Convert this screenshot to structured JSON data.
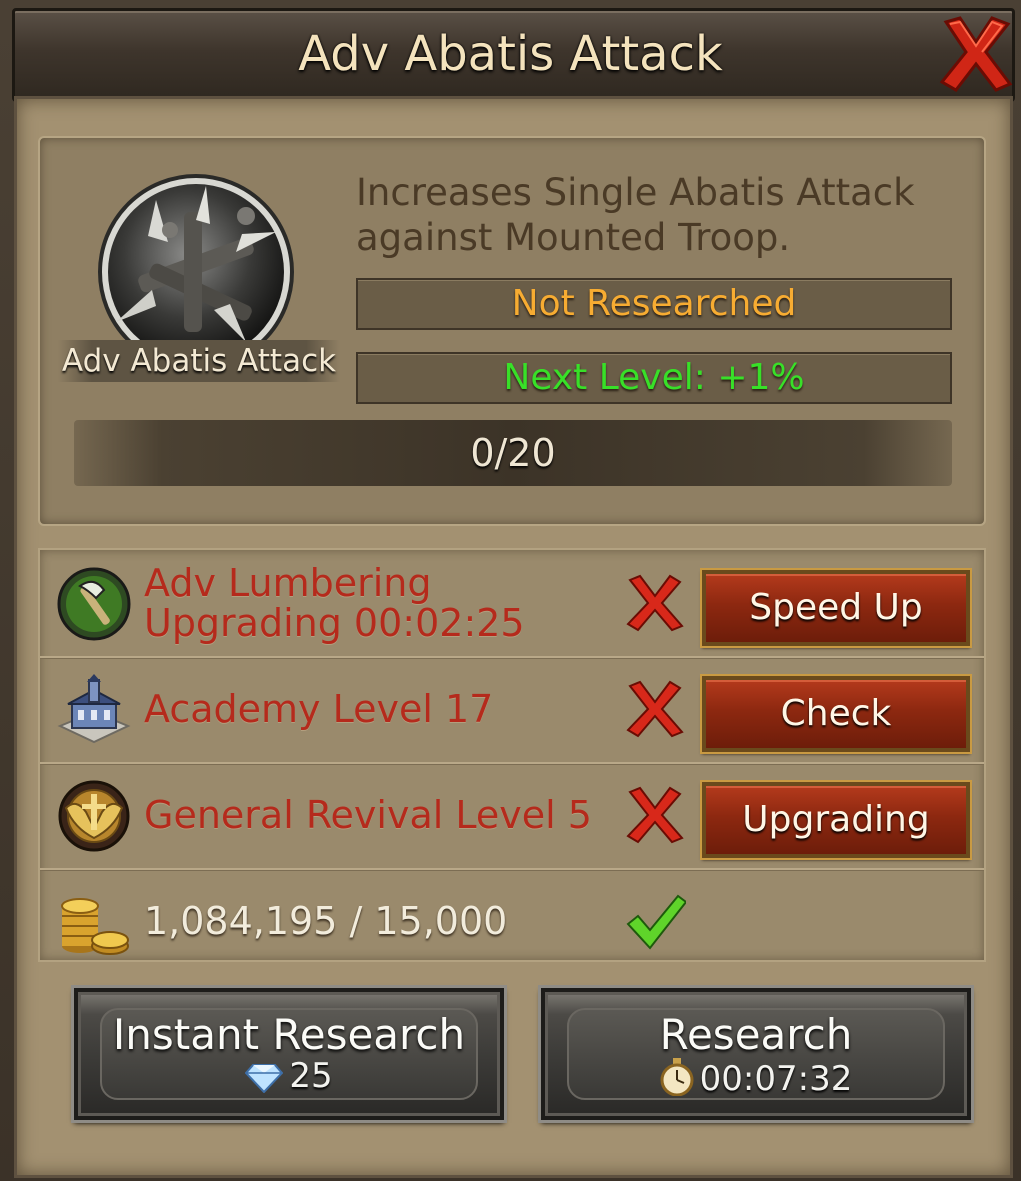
{
  "header": {
    "title": "Adv Abatis Attack"
  },
  "research": {
    "icon_name": "abatis-spike-icon",
    "name_label": "Adv Abatis Attack",
    "description": "Increases Single Abatis Attack against Mounted Troop.",
    "status": "Not Researched",
    "next_level": "Next Level: +1%",
    "progress_text": "0/20",
    "progress_fraction": 0
  },
  "requirements": [
    {
      "icon": "lumbering-axe-icon",
      "line1": "Adv Lumbering",
      "line2": "Upgrading 00:02:25",
      "met": false,
      "button": "Speed Up"
    },
    {
      "icon": "academy-building-icon",
      "text": "Academy Level 17",
      "met": false,
      "button": "Check"
    },
    {
      "icon": "general-revival-emblem-icon",
      "text": "General Revival Level 5",
      "met": false,
      "button": "Upgrading"
    },
    {
      "icon": "gold-coins-icon",
      "text": "1,084,195 / 15,000",
      "met": true
    }
  ],
  "footer": {
    "instant_label": "Instant Research",
    "instant_cost": "25",
    "instant_icon": "diamond-icon",
    "research_label": "Research",
    "research_time": "00:07:32",
    "research_icon": "stopwatch-icon"
  },
  "colors": {
    "status_not_researched": "#f7ac32",
    "next_level": "#38e028",
    "requirement_unmet": "#b52a1c"
  }
}
